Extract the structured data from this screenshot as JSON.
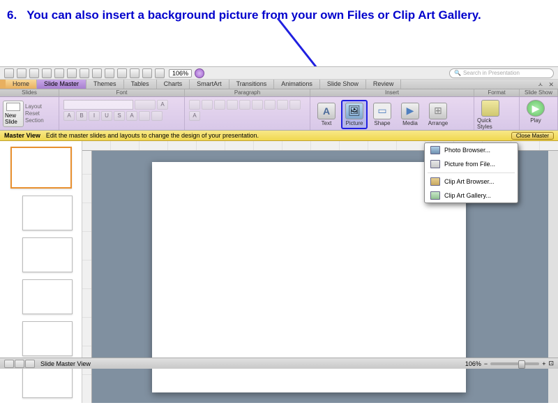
{
  "instruction": {
    "num": "6.",
    "text": "You can also insert a background picture from your own Files or Clip Art Gallery."
  },
  "toolbar": {
    "zoom": "106%"
  },
  "search": {
    "placeholder": "Search in Presentation"
  },
  "tabs": {
    "home": "Home",
    "slide_master": "Slide Master",
    "themes": "Themes",
    "tables": "Tables",
    "charts": "Charts",
    "smartart": "SmartArt",
    "transitions": "Transitions",
    "animations": "Animations",
    "slide_show": "Slide Show",
    "review": "Review"
  },
  "groups": {
    "slides": "Slides",
    "font": "Font",
    "paragraph": "Paragraph",
    "insert": "Insert",
    "format": "Format",
    "slideshow": "Slide Show"
  },
  "slides_group": {
    "new_slide": "New Slide",
    "layout": "Layout",
    "reset": "Reset",
    "section": "Section"
  },
  "insert_buttons": {
    "text": "Text",
    "picture": "Picture",
    "shape": "Shape",
    "media": "Media",
    "arrange": "Arrange"
  },
  "format_buttons": {
    "quick_styles": "Quick Styles"
  },
  "slideshow_buttons": {
    "play": "Play"
  },
  "picture_menu": {
    "photo_browser": "Photo Browser...",
    "picture_from_file": "Picture from File...",
    "clip_art_browser": "Clip Art Browser...",
    "clip_art_gallery": "Clip Art Gallery..."
  },
  "master_bar": {
    "title": "Master View",
    "msg": "Edit the master slides and layouts to change the design of your presentation.",
    "close": "Close Master"
  },
  "statusbar": {
    "mode": "Slide Master View",
    "zoom": "106%"
  }
}
